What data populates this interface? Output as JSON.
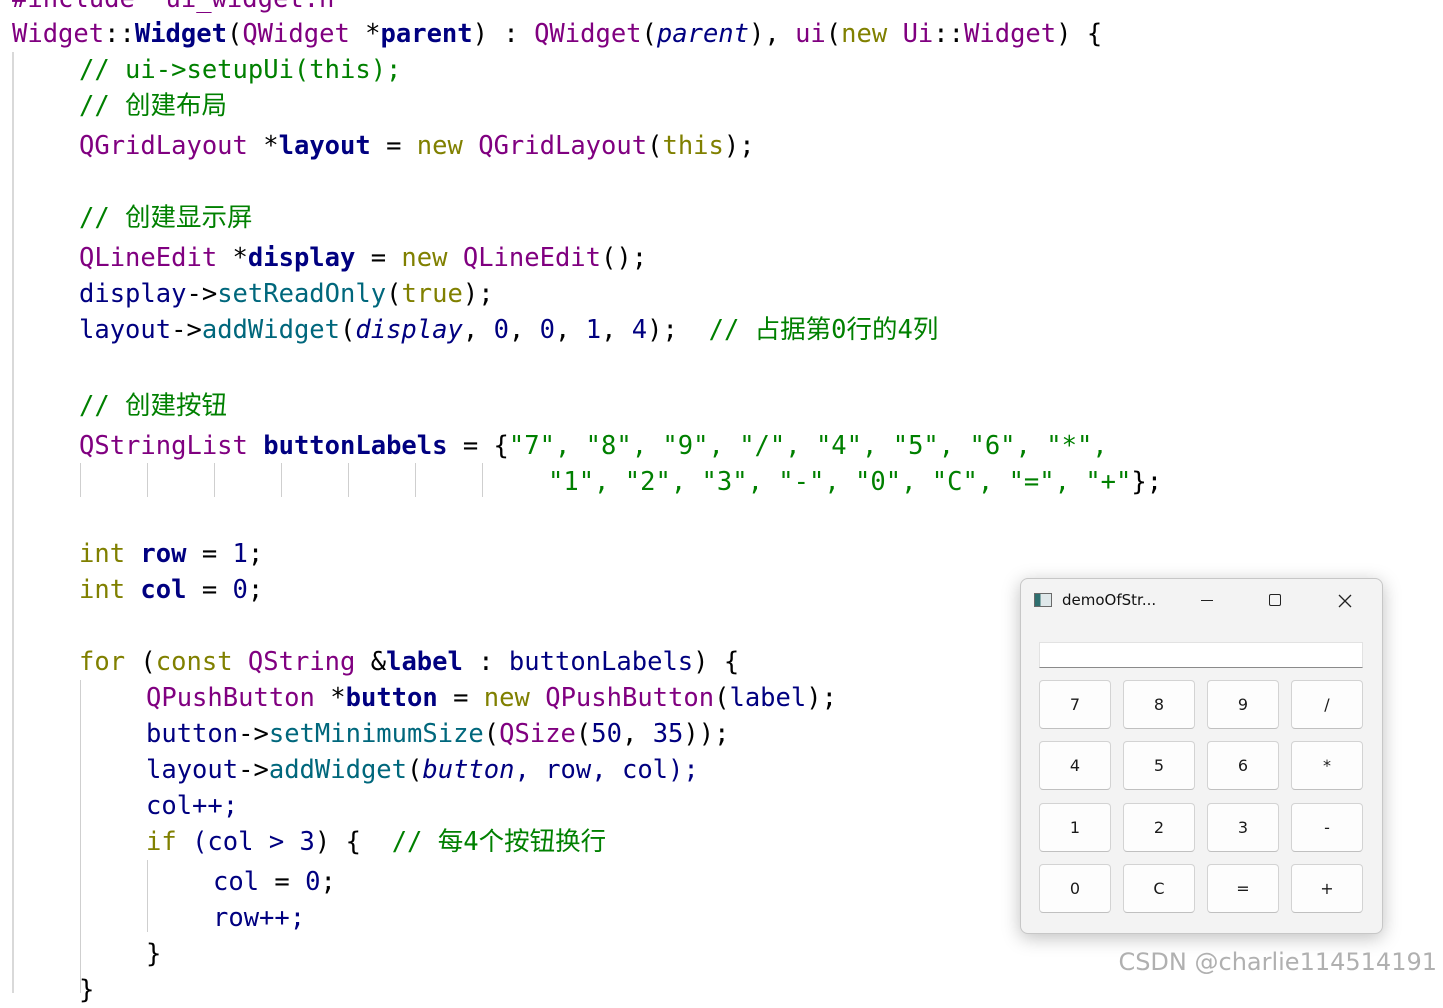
{
  "editor": {
    "line0": "#include \"ui_widget.h\"",
    "line1": {
      "cls": "Widget",
      "sep": "::",
      "ctor": "Widget",
      "p1": "(",
      "qw": "QWidget",
      "star": " *",
      "param": "parent",
      "p2": ") : ",
      "base": "QWidget",
      "p3": "(",
      "parentArg": "parent",
      "p4": "), ",
      "ui": "ui",
      "p5": "(",
      "newkw": "new",
      "sp": " ",
      "uiNs": "Ui",
      "sep2": "::",
      "uiW": "Widget",
      "p6": ") {"
    },
    "c_setup": "// ui->setupUi(this);",
    "c_layout": "// 创建布局",
    "layout_line": {
      "type": "QGridLayout",
      "star": " *",
      "var": "layout",
      "eq": " = ",
      "newkw": "new",
      "sp": " ",
      "ctor": "QGridLayout",
      "open": "(",
      "thiskw": "this",
      "close": ");"
    },
    "c_display": "// 创建显示屏",
    "display_line": {
      "type": "QLineEdit",
      "star": " *",
      "var": "display",
      "eq": " = ",
      "newkw": "new",
      "sp": " ",
      "ctor": "QLineEdit",
      "rest": "();"
    },
    "readonly_line": {
      "obj": "display",
      "arrow": "->",
      "fn": "setReadOnly",
      "open": "(",
      "val": "true",
      "close": ");"
    },
    "add_display": {
      "obj": "layout",
      "arrow": "->",
      "fn": "addWidget",
      "open": "(",
      "arg": "display",
      "comma": ", ",
      "n0": "0",
      "c1": ", ",
      "n1": "0",
      "c2": ", ",
      "n2": "1",
      "c3": ", ",
      "n3": "4",
      "close": ");",
      "gap": "  ",
      "comment": "// 占据第0行的4列"
    },
    "c_buttons": "// 创建按钮",
    "labels_line1": {
      "type": "QStringList",
      "sp": " ",
      "var": "buttonLabels",
      "eq": " = {",
      "strs": "\"7\", \"8\", \"9\", \"/\", \"4\", \"5\", \"6\", \"*\",",
      "trail": ""
    },
    "labels_line2": {
      "strs": "\"1\", \"2\", \"3\", \"-\", \"0\", \"C\", \"=\", \"+\"",
      "end": "};"
    },
    "row_line": {
      "kw": "int",
      "sp": " ",
      "var": "row",
      "eq": " = ",
      "val": "1",
      "semi": ";"
    },
    "col_line": {
      "kw": "int",
      "sp": " ",
      "var": "col",
      "eq": " = ",
      "val": "0",
      "semi": ";"
    },
    "for_line": {
      "kw": "for",
      "p1": " (",
      "constkw": "const",
      "sp": " ",
      "type": "QString",
      "amp": " &",
      "var": "label",
      "colon": " : ",
      "coll": "buttonLabels",
      "end": ") {"
    },
    "btn_line": {
      "type": "QPushButton",
      "star": " *",
      "var": "button",
      "eq": " = ",
      "newkw": "new",
      "sp": " ",
      "ctor": "QPushButton",
      "open": "(",
      "arg": "label",
      "close": ");"
    },
    "minsize_line": {
      "obj": "button",
      "arrow": "->",
      "fn": "setMinimumSize",
      "open": "(",
      "type": "QSize",
      "o2": "(",
      "a": "50",
      "comma": ", ",
      "b": "35",
      "close": "));"
    },
    "addbtn_line": {
      "obj": "layout",
      "arrow": "->",
      "fn": "addWidget",
      "open": "(",
      "arg": "button",
      "rest": ", row, col);"
    },
    "colpp": "col++;",
    "if_line": {
      "kw": "if",
      "cond": " (col > ",
      "num": "3",
      "end": ") {",
      "gap": "  ",
      "comment": "// 每4个按钮换行"
    },
    "colreset": {
      "var": "col",
      "eq": " = ",
      "val": "0",
      "semi": ";"
    },
    "rowpp": "row++;",
    "close_if": "}",
    "close_for": "}"
  },
  "window": {
    "title": "demoOfStr...",
    "display_value": "",
    "buttons": [
      "7",
      "8",
      "9",
      "/",
      "4",
      "5",
      "6",
      "*",
      "1",
      "2",
      "3",
      "-",
      "0",
      "C",
      "=",
      "+"
    ]
  },
  "watermark": "CSDN @charlie114514191"
}
